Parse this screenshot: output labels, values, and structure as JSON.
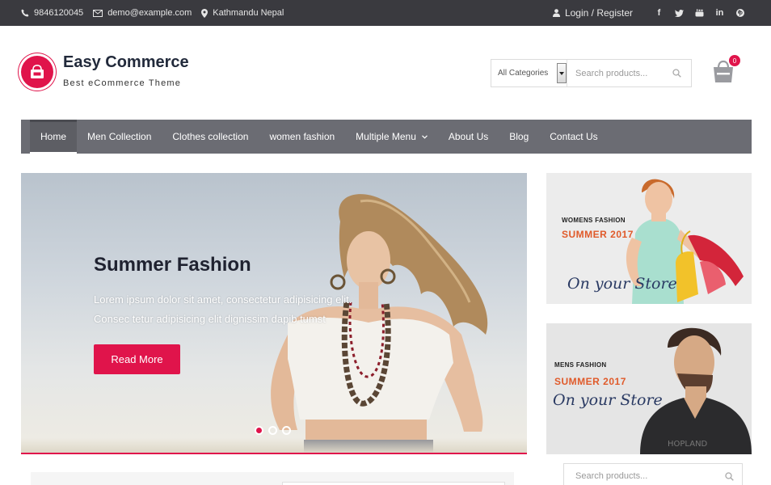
{
  "topbar": {
    "phone": "9846120045",
    "email": "demo@example.com",
    "location": "Kathmandu Nepal",
    "login": "Login / Register",
    "social": [
      "facebook-icon",
      "twitter-icon",
      "youtube-icon",
      "linkedin-icon",
      "pinterest-icon"
    ]
  },
  "header": {
    "title": "Easy Commerce",
    "tagline": "Best eCommerce Theme",
    "category_select": "All Categories",
    "search_placeholder": "Search products...",
    "cart_count": "0"
  },
  "nav": {
    "items": [
      {
        "label": "Home"
      },
      {
        "label": "Men Collection"
      },
      {
        "label": "Clothes collection"
      },
      {
        "label": "women fashion"
      },
      {
        "label": "Multiple Menu"
      },
      {
        "label": "About Us"
      },
      {
        "label": "Blog"
      },
      {
        "label": "Contact Us"
      }
    ]
  },
  "slider": {
    "title": "Summer Fashion",
    "line1": "Lorem ipsum dolor sit amet, consectetur adipisicing elit.",
    "line2": "Consec tetur adipisicing elit dignissim dapib tumst",
    "button": "Read More",
    "slides": 3,
    "active_slide": 1
  },
  "banners": [
    {
      "small": "WOMENS FASHION",
      "season": "SUMMER 2017",
      "script": "On your Store"
    },
    {
      "small": "MENS FASHION",
      "season": "SUMMER 2017",
      "script": "On your Store"
    }
  ],
  "sidebar": {
    "search_placeholder": "Search products..."
  },
  "colors": {
    "accent": "#e0144b",
    "topbar": "#3a3a3f",
    "nav": "#6b6c73"
  }
}
